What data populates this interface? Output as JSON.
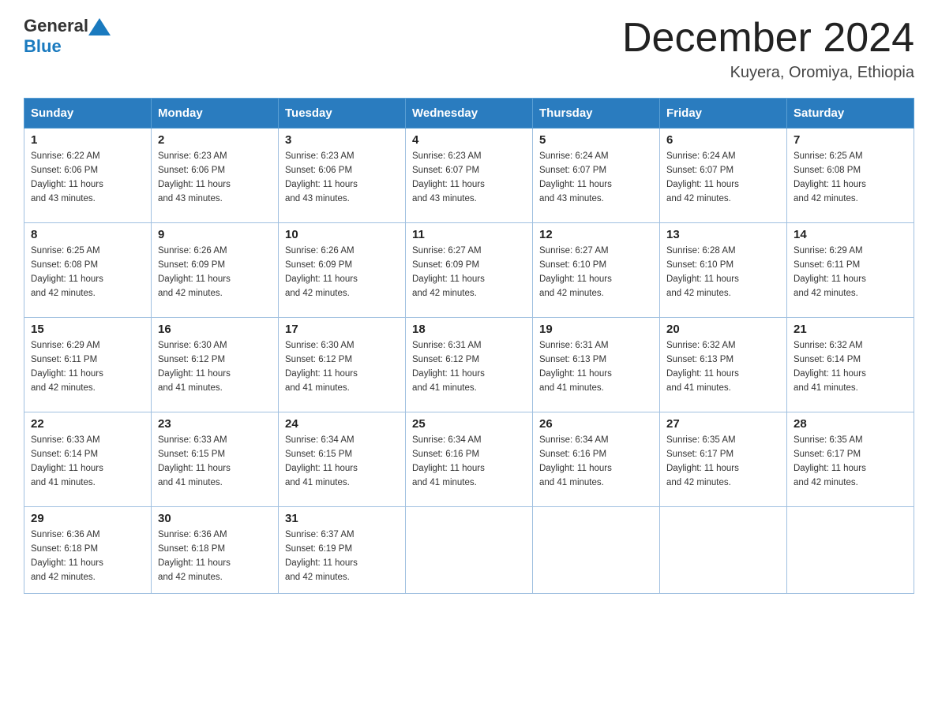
{
  "header": {
    "logo_general": "General",
    "logo_blue": "Blue",
    "month_title": "December 2024",
    "location": "Kuyera, Oromiya, Ethiopia"
  },
  "weekdays": [
    "Sunday",
    "Monday",
    "Tuesday",
    "Wednesday",
    "Thursday",
    "Friday",
    "Saturday"
  ],
  "weeks": [
    [
      {
        "day": "1",
        "sunrise": "6:22 AM",
        "sunset": "6:06 PM",
        "daylight": "11 hours and 43 minutes."
      },
      {
        "day": "2",
        "sunrise": "6:23 AM",
        "sunset": "6:06 PM",
        "daylight": "11 hours and 43 minutes."
      },
      {
        "day": "3",
        "sunrise": "6:23 AM",
        "sunset": "6:06 PM",
        "daylight": "11 hours and 43 minutes."
      },
      {
        "day": "4",
        "sunrise": "6:23 AM",
        "sunset": "6:07 PM",
        "daylight": "11 hours and 43 minutes."
      },
      {
        "day": "5",
        "sunrise": "6:24 AM",
        "sunset": "6:07 PM",
        "daylight": "11 hours and 43 minutes."
      },
      {
        "day": "6",
        "sunrise": "6:24 AM",
        "sunset": "6:07 PM",
        "daylight": "11 hours and 42 minutes."
      },
      {
        "day": "7",
        "sunrise": "6:25 AM",
        "sunset": "6:08 PM",
        "daylight": "11 hours and 42 minutes."
      }
    ],
    [
      {
        "day": "8",
        "sunrise": "6:25 AM",
        "sunset": "6:08 PM",
        "daylight": "11 hours and 42 minutes."
      },
      {
        "day": "9",
        "sunrise": "6:26 AM",
        "sunset": "6:09 PM",
        "daylight": "11 hours and 42 minutes."
      },
      {
        "day": "10",
        "sunrise": "6:26 AM",
        "sunset": "6:09 PM",
        "daylight": "11 hours and 42 minutes."
      },
      {
        "day": "11",
        "sunrise": "6:27 AM",
        "sunset": "6:09 PM",
        "daylight": "11 hours and 42 minutes."
      },
      {
        "day": "12",
        "sunrise": "6:27 AM",
        "sunset": "6:10 PM",
        "daylight": "11 hours and 42 minutes."
      },
      {
        "day": "13",
        "sunrise": "6:28 AM",
        "sunset": "6:10 PM",
        "daylight": "11 hours and 42 minutes."
      },
      {
        "day": "14",
        "sunrise": "6:29 AM",
        "sunset": "6:11 PM",
        "daylight": "11 hours and 42 minutes."
      }
    ],
    [
      {
        "day": "15",
        "sunrise": "6:29 AM",
        "sunset": "6:11 PM",
        "daylight": "11 hours and 42 minutes."
      },
      {
        "day": "16",
        "sunrise": "6:30 AM",
        "sunset": "6:12 PM",
        "daylight": "11 hours and 41 minutes."
      },
      {
        "day": "17",
        "sunrise": "6:30 AM",
        "sunset": "6:12 PM",
        "daylight": "11 hours and 41 minutes."
      },
      {
        "day": "18",
        "sunrise": "6:31 AM",
        "sunset": "6:12 PM",
        "daylight": "11 hours and 41 minutes."
      },
      {
        "day": "19",
        "sunrise": "6:31 AM",
        "sunset": "6:13 PM",
        "daylight": "11 hours and 41 minutes."
      },
      {
        "day": "20",
        "sunrise": "6:32 AM",
        "sunset": "6:13 PM",
        "daylight": "11 hours and 41 minutes."
      },
      {
        "day": "21",
        "sunrise": "6:32 AM",
        "sunset": "6:14 PM",
        "daylight": "11 hours and 41 minutes."
      }
    ],
    [
      {
        "day": "22",
        "sunrise": "6:33 AM",
        "sunset": "6:14 PM",
        "daylight": "11 hours and 41 minutes."
      },
      {
        "day": "23",
        "sunrise": "6:33 AM",
        "sunset": "6:15 PM",
        "daylight": "11 hours and 41 minutes."
      },
      {
        "day": "24",
        "sunrise": "6:34 AM",
        "sunset": "6:15 PM",
        "daylight": "11 hours and 41 minutes."
      },
      {
        "day": "25",
        "sunrise": "6:34 AM",
        "sunset": "6:16 PM",
        "daylight": "11 hours and 41 minutes."
      },
      {
        "day": "26",
        "sunrise": "6:34 AM",
        "sunset": "6:16 PM",
        "daylight": "11 hours and 41 minutes."
      },
      {
        "day": "27",
        "sunrise": "6:35 AM",
        "sunset": "6:17 PM",
        "daylight": "11 hours and 42 minutes."
      },
      {
        "day": "28",
        "sunrise": "6:35 AM",
        "sunset": "6:17 PM",
        "daylight": "11 hours and 42 minutes."
      }
    ],
    [
      {
        "day": "29",
        "sunrise": "6:36 AM",
        "sunset": "6:18 PM",
        "daylight": "11 hours and 42 minutes."
      },
      {
        "day": "30",
        "sunrise": "6:36 AM",
        "sunset": "6:18 PM",
        "daylight": "11 hours and 42 minutes."
      },
      {
        "day": "31",
        "sunrise": "6:37 AM",
        "sunset": "6:19 PM",
        "daylight": "11 hours and 42 minutes."
      },
      null,
      null,
      null,
      null
    ]
  ],
  "labels": {
    "sunrise": "Sunrise:",
    "sunset": "Sunset:",
    "daylight": "Daylight:"
  }
}
